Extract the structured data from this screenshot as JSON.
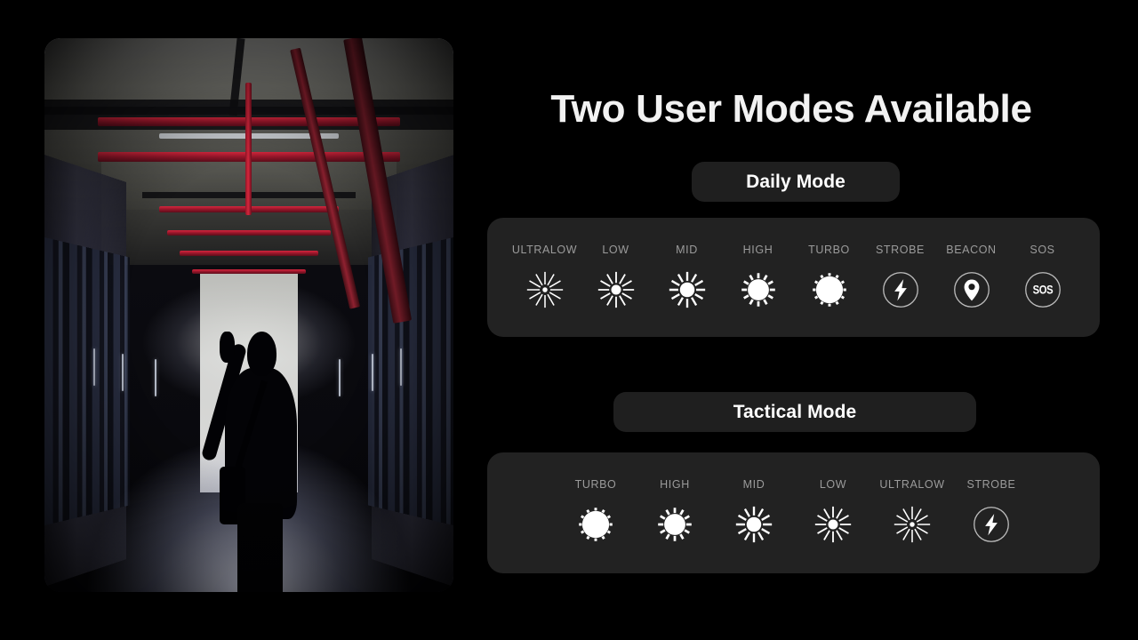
{
  "headline": "Two User Modes Available",
  "photo": {
    "alt_description": "Person in dark corridor holding flashlight beam",
    "name": "flashlight-corridor-photo"
  },
  "colors": {
    "background": "#000000",
    "panel": "#222222",
    "button": "#1f1f1f",
    "headline_text": "#f2f2f2",
    "button_text": "#ffffff",
    "label_text": "#9b9b9b",
    "icon": "#ffffff"
  },
  "daily": {
    "button_label": "Daily Mode",
    "modes": [
      {
        "label": "ULTRALOW",
        "icon": "sun-rays-tiny-icon"
      },
      {
        "label": "LOW",
        "icon": "sun-rays-small-icon"
      },
      {
        "label": "MID",
        "icon": "sun-rays-medium-icon"
      },
      {
        "label": "HIGH",
        "icon": "sun-burst-large-icon"
      },
      {
        "label": "TURBO",
        "icon": "sun-full-icon"
      },
      {
        "label": "STROBE",
        "icon": "lightning-bolt-icon"
      },
      {
        "label": "BEACON",
        "icon": "map-pin-icon"
      },
      {
        "label": "SOS",
        "icon": "sos-circle-icon"
      }
    ]
  },
  "tactical": {
    "button_label": "Tactical Mode",
    "modes": [
      {
        "label": "TURBO",
        "icon": "sun-full-icon"
      },
      {
        "label": "HIGH",
        "icon": "sun-burst-large-icon"
      },
      {
        "label": "MID",
        "icon": "sun-rays-medium-icon"
      },
      {
        "label": "LOW",
        "icon": "sun-rays-small-icon"
      },
      {
        "label": "ULTRALOW",
        "icon": "sun-rays-tiny-icon"
      },
      {
        "label": "STROBE",
        "icon": "lightning-bolt-icon"
      }
    ]
  },
  "sos_text": "SOS"
}
